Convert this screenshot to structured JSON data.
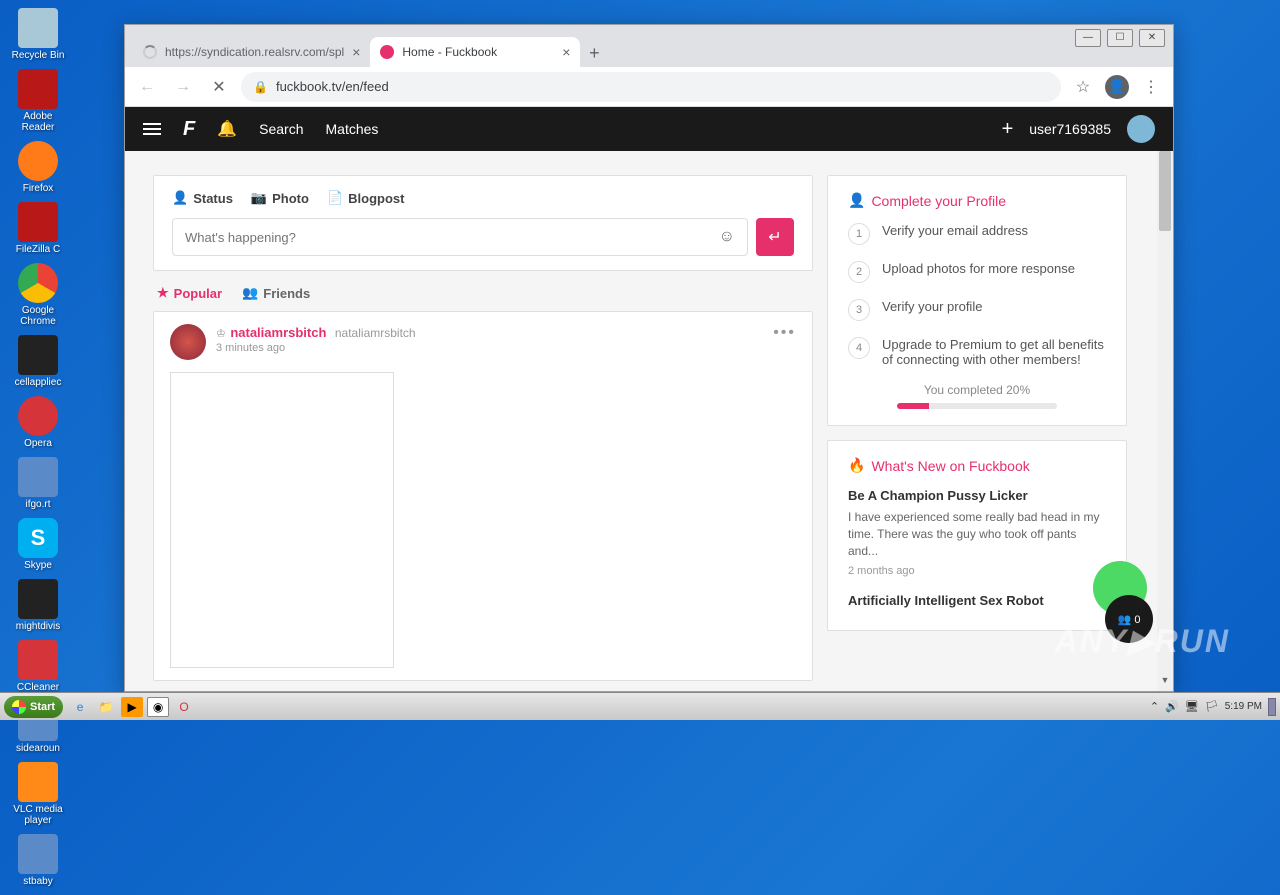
{
  "desktop": {
    "icons": [
      {
        "label": "Recycle Bin",
        "color": "#a8c8d8"
      },
      {
        "label": "Adobe Reader",
        "color": "#b81818"
      },
      {
        "label": "",
        "color": "#5a8ac8"
      },
      {
        "label": "Firefox",
        "color": "#ff7a18"
      },
      {
        "label": "FileZilla C",
        "color": "#b81818"
      },
      {
        "label": "",
        "color": ""
      },
      {
        "label": "Google Chrome",
        "color": "#4285f4"
      },
      {
        "label": "cellappliec",
        "color": "#222"
      },
      {
        "label": "",
        "color": ""
      },
      {
        "label": "Opera",
        "color": "#d4343a"
      },
      {
        "label": "ifgo.rt",
        "color": "#5a8ac8"
      },
      {
        "label": "",
        "color": ""
      },
      {
        "label": "Skype",
        "color": "#00aff0"
      },
      {
        "label": "mightdivis",
        "color": "#222"
      },
      {
        "label": "",
        "color": ""
      },
      {
        "label": "CCleaner",
        "color": "#d4343a"
      },
      {
        "label": "sidearoun",
        "color": "#5a8ac8"
      },
      {
        "label": "",
        "color": ""
      },
      {
        "label": "VLC media player",
        "color": "#ff8a18"
      },
      {
        "label": "stbaby",
        "color": "#5a8ac8"
      }
    ]
  },
  "browser": {
    "tabs": [
      {
        "title": "https://syndication.realsrv.com/spl",
        "active": false
      },
      {
        "title": "Home - Fuckbook",
        "active": true
      }
    ],
    "url": "fuckbook.tv/en/feed"
  },
  "site": {
    "nav": {
      "search": "Search",
      "matches": "Matches"
    },
    "username": "user7169385"
  },
  "compose": {
    "tabs": {
      "status": "Status",
      "photo": "Photo",
      "blogpost": "Blogpost"
    },
    "placeholder": "What's happening?"
  },
  "feed": {
    "tabs": {
      "popular": "Popular",
      "friends": "Friends"
    },
    "post": {
      "author": "nataliamrsbitch",
      "handle": "nataliamrsbitch",
      "time": "3 minutes ago"
    }
  },
  "profile_card": {
    "title": "Complete your Profile",
    "steps": [
      "Verify your email address",
      "Upload photos for more response",
      "Verify your profile",
      "Upgrade to Premium to get all benefits of connecting with other members!"
    ],
    "progress_label": "You completed 20%"
  },
  "news_card": {
    "title": "What's New on Fuckbook",
    "item1_title": "Be A Champion Pussy Licker",
    "item1_text": "I have experienced some really bad head in my time. There was the guy who took off pants and...",
    "item1_time": "2 months ago",
    "item2_title": "Artificially Intelligent Sex Robot"
  },
  "float_badge": "👥 0",
  "taskbar": {
    "start": "Start",
    "time": "5:19 PM"
  },
  "watermark": "ANY▶RUN"
}
